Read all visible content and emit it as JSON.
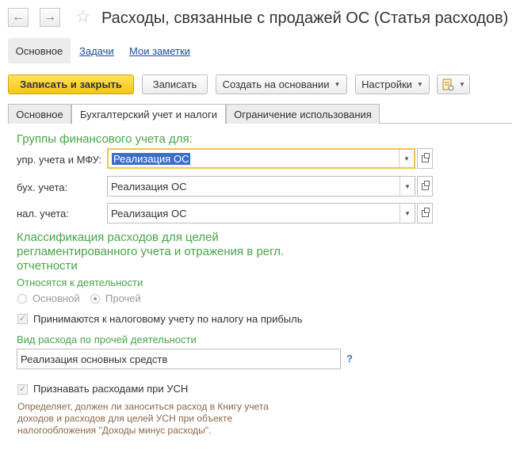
{
  "window": {
    "title": "Расходы, связанные с продажей ОС (Статья расходов)",
    "back_icon": "←",
    "forward_icon": "→",
    "favorite_icon": "☆"
  },
  "topnav": {
    "items": [
      "Основное",
      "Задачи",
      "Мои заметки"
    ]
  },
  "toolbar": {
    "save_close": "Записать и закрыть",
    "save": "Записать",
    "create_based": "Создать на основании",
    "settings": "Настройки"
  },
  "tabs": [
    "Основное",
    "Бухгалтерский учет и налоги",
    "Ограничение использования"
  ],
  "groups": {
    "heading": "Группы финансового учета для:",
    "rows": [
      {
        "label": "упр. учета и МФУ:",
        "value": "Реализация ОС"
      },
      {
        "label": "бух. учета:",
        "value": "Реализация ОС"
      },
      {
        "label": "нал. учета:",
        "value": "Реализация ОС"
      }
    ]
  },
  "classification": {
    "heading": "Классификация расходов для целей регламентированного учета и отражения в регл. отчетности",
    "activity_label": "Относятся к деятельности",
    "radio1": "Основной",
    "radio2": "Прочей",
    "tax_accept": "Принимаются к налоговому учету по налогу на прибыль",
    "other_activity_label": "Вид расхода по прочей деятельности",
    "other_activity_value": "Реализация основных средств",
    "help": "?",
    "usn_label": "Признавать расходами при УСН",
    "usn_desc": "Определяет, должен ли заноситься расход в Книгу учета доходов и расходов для целей УСН при объекте налогообложения \"Доходы минус расходы\"."
  },
  "colors": {
    "accent_green": "#4aa34a",
    "primary_yellow": "#f5c518",
    "link_blue": "#1a4c9a"
  }
}
